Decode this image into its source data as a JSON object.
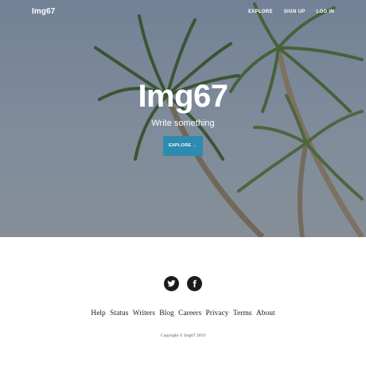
{
  "nav": {
    "brand": "Img67",
    "links": [
      "EXPLORE",
      "SIGN UP",
      "LOG IN"
    ]
  },
  "hero": {
    "title": "Img67",
    "subtitle": "Write something",
    "cta_label": "EXPLORE →",
    "background": "palm-trees-photo"
  },
  "footer": {
    "social": [
      "twitter-icon",
      "facebook-icon"
    ],
    "links": [
      "Help",
      "Status",
      "Writers",
      "Blog",
      "Careers",
      "Privacy",
      "Terms",
      "About"
    ],
    "copyright": "Copyright © Img67 2019"
  },
  "colors": {
    "cta": "#2d8bb0",
    "social_bg": "#1b1b1b",
    "text_dark": "#222222"
  }
}
